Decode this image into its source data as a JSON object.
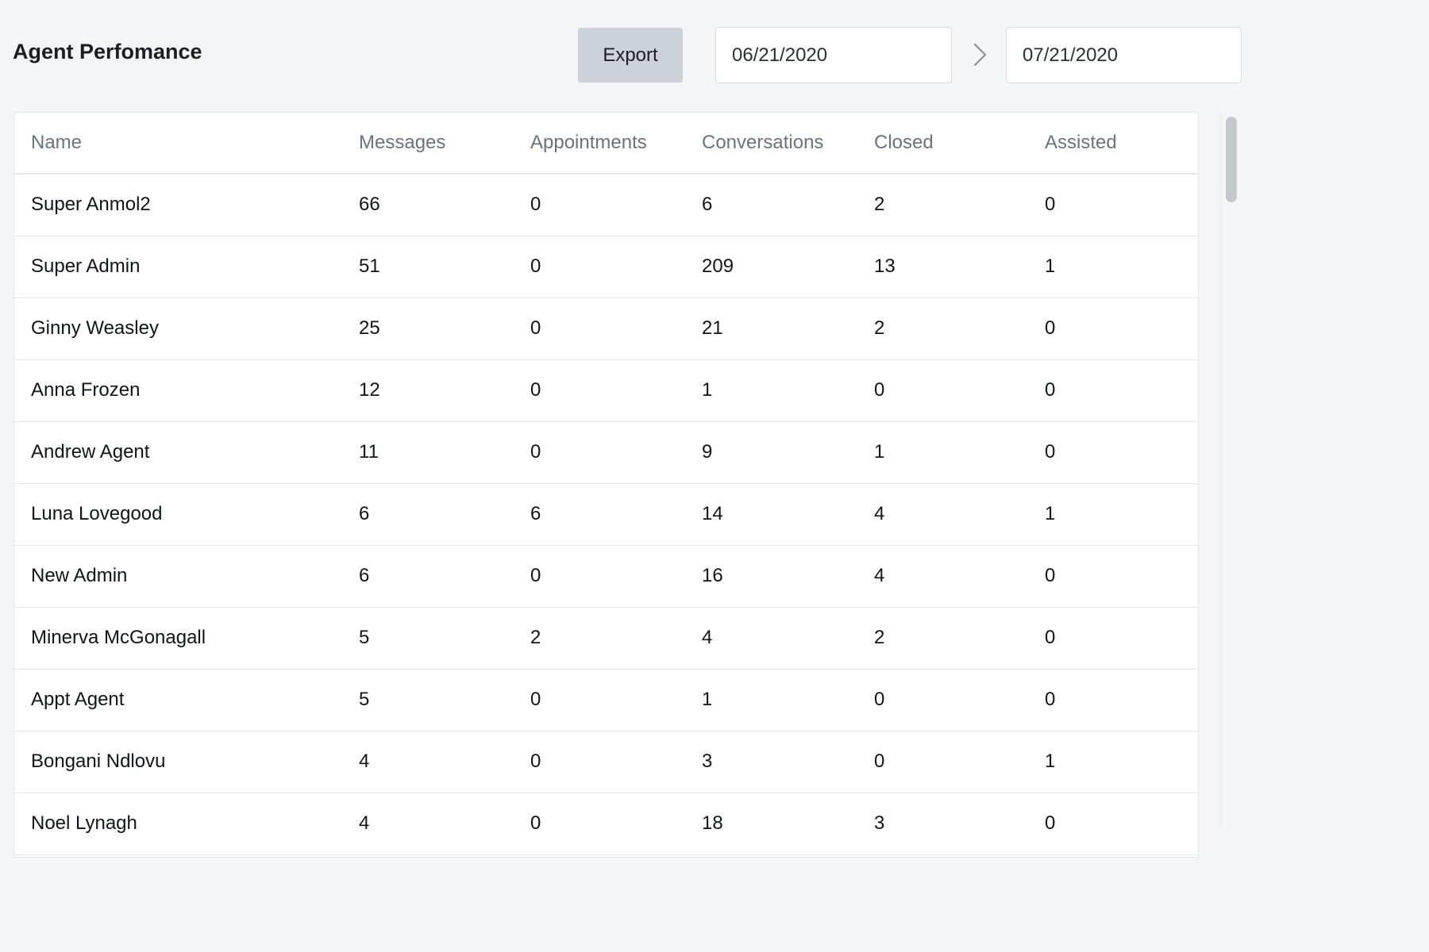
{
  "header": {
    "title": "Agent Perfomance",
    "export_label": "Export",
    "date_start": "06/21/2020",
    "date_end": "07/21/2020"
  },
  "table": {
    "columns": [
      "Name",
      "Messages",
      "Appointments",
      "Conversations",
      "Closed",
      "Assisted"
    ],
    "rows": [
      [
        "Super Anmol2",
        "66",
        "0",
        "6",
        "2",
        "0"
      ],
      [
        "Super Admin",
        "51",
        "0",
        "209",
        "13",
        "1"
      ],
      [
        "Ginny Weasley",
        "25",
        "0",
        "21",
        "2",
        "0"
      ],
      [
        "Anna Frozen",
        "12",
        "0",
        "1",
        "0",
        "0"
      ],
      [
        "Andrew Agent",
        "11",
        "0",
        "9",
        "1",
        "0"
      ],
      [
        "Luna Lovegood",
        "6",
        "6",
        "14",
        "4",
        "1"
      ],
      [
        "New Admin",
        "6",
        "0",
        "16",
        "4",
        "0"
      ],
      [
        "Minerva McGonagall",
        "5",
        "2",
        "4",
        "2",
        "0"
      ],
      [
        "Appt Agent",
        "5",
        "0",
        "1",
        "0",
        "0"
      ],
      [
        "Bongani Ndlovu",
        "4",
        "0",
        "3",
        "0",
        "1"
      ],
      [
        "Noel Lynagh",
        "4",
        "0",
        "18",
        "3",
        "0"
      ]
    ]
  },
  "icons": {
    "range_separator": "chevron-right-icon"
  },
  "colors": {
    "background": "#f4f5f7",
    "export_button": "#cdd1da",
    "header_text": "#6a737d"
  }
}
